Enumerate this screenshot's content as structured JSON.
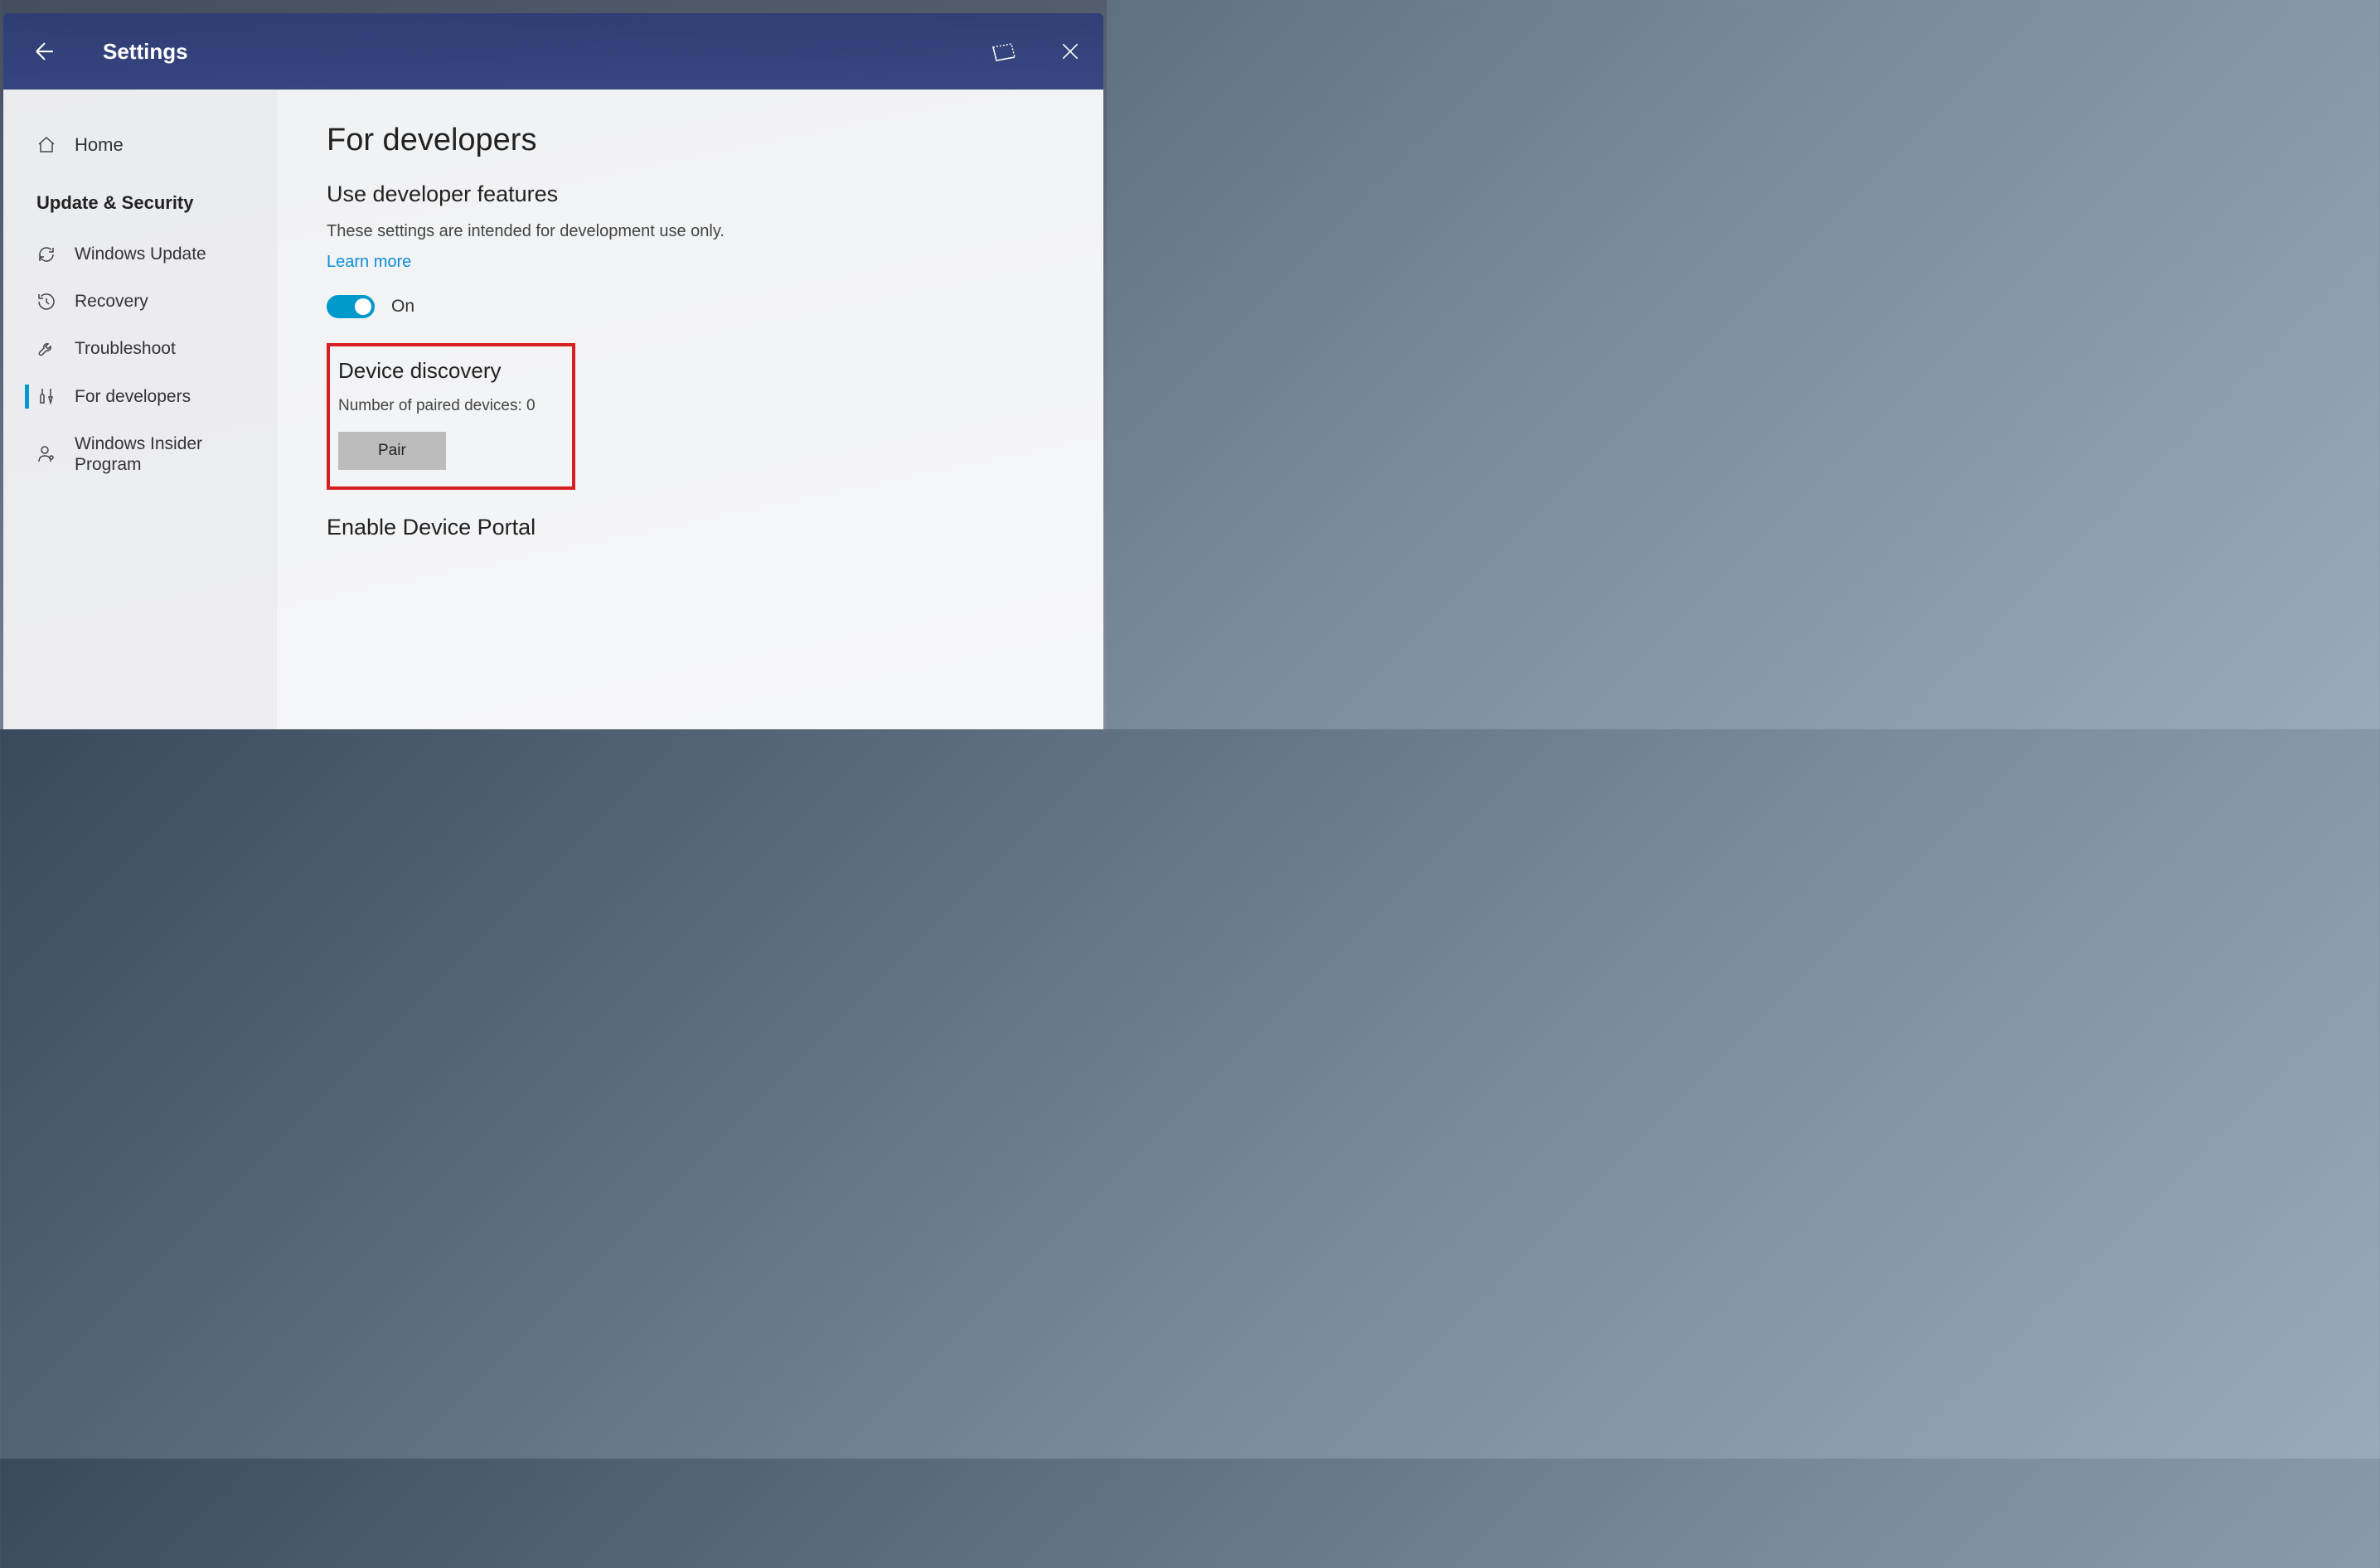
{
  "titlebar": {
    "title": "Settings"
  },
  "sidebar": {
    "home_label": "Home",
    "section_title": "Update & Security",
    "items": [
      {
        "label": "Windows Update"
      },
      {
        "label": "Recovery"
      },
      {
        "label": "Troubleshoot"
      },
      {
        "label": "For developers"
      },
      {
        "label": "Windows Insider Program"
      }
    ]
  },
  "main": {
    "page_title": "For developers",
    "dev_features_title": "Use developer features",
    "dev_features_desc": "These settings are intended for development use only.",
    "learn_more_label": "Learn more",
    "toggle_label": "On",
    "device_discovery_title": "Device discovery",
    "paired_devices_text": "Number of paired devices: 0",
    "pair_button_label": "Pair",
    "device_portal_title": "Enable Device Portal"
  }
}
